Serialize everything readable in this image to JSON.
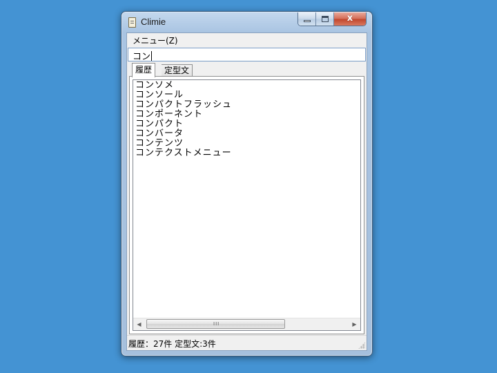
{
  "window": {
    "title": "Climie",
    "close_label": "x"
  },
  "menubar": {
    "menu_label": "メニュー(Z)"
  },
  "input": {
    "value": "コン"
  },
  "tabs": [
    {
      "label": "履歴",
      "active": true
    },
    {
      "label": "定型文",
      "active": false
    }
  ],
  "list": {
    "items": [
      "コンソメ",
      "コンソール",
      "コンパクトフラッシュ",
      "コンポーネント",
      "コンパクト",
      "コンバータ",
      "コンテンツ",
      "コンテクストメニュー"
    ]
  },
  "scrollbar": {
    "grip": "III",
    "left_arrow": "◀",
    "right_arrow": "▶"
  },
  "status": {
    "text": "履歴：27件 定型文:3件"
  },
  "colors": {
    "desktop": "#4493d3",
    "close_button": "#c0452c",
    "frame": "#a9c4e2"
  }
}
